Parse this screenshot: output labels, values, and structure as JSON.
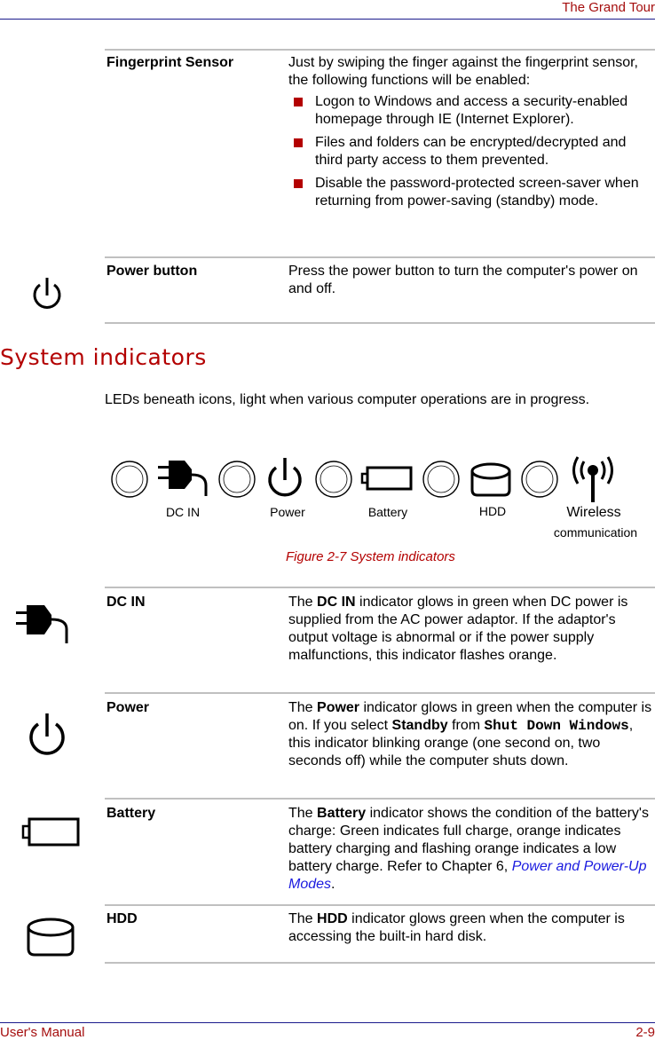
{
  "header": {
    "title": "The Grand Tour"
  },
  "footer": {
    "left": "User's Manual",
    "right": "2-9"
  },
  "features": [
    {
      "term": "Fingerprint Sensor",
      "intro": "Just by swiping the finger against the fingerprint sensor, the following functions will be enabled:",
      "bullets": [
        "Logon to Windows and access a security-enabled homepage through IE (Internet Explorer).",
        "Files and folders can be encrypted/decrypted and third party access to them prevented.",
        "Disable the password-protected screen-saver when returning from power-saving (standby) mode."
      ]
    },
    {
      "term": "Power button",
      "icon": "power-icon",
      "description": "Press the power button to turn the computer's power on and off."
    }
  ],
  "section": {
    "title": "System indicators",
    "intro": "LEDs beneath icons, light when various computer operations are in progress."
  },
  "figure": {
    "labels": [
      "DC IN",
      "Power",
      "Battery",
      "HDD",
      "Wireless",
      "communication"
    ],
    "caption": "Figure 2-7 System indicators"
  },
  "indicators": [
    {
      "term": "DC IN",
      "icon": "dc-in-plug-icon",
      "parts": {
        "a": "The ",
        "b": "DC IN",
        "c": " indicator glows in green when DC power is supplied from the AC power adaptor. If the adaptor's output voltage is abnormal or if the power supply malfunctions, this indicator flashes orange."
      }
    },
    {
      "term": "Power",
      "icon": "power-icon",
      "parts": {
        "a": "The ",
        "b": "Power",
        "c": " indicator glows in green when the computer is on. If you select ",
        "d": "Standby",
        "e": " from ",
        "f": "Shut Down Windows",
        "g": ", this indicator blinking orange (one second on, two seconds off) while the computer shuts down."
      }
    },
    {
      "term": "Battery",
      "icon": "battery-icon",
      "parts": {
        "a": "The ",
        "b": "Battery",
        "c": " indicator shows the condition of the battery's charge: Green indicates full charge, orange indicates battery charging and flashing orange indicates a low battery charge. Refer to Chapter 6, ",
        "link": "Power and Power-Up Modes",
        "d": "."
      }
    },
    {
      "term": "HDD",
      "icon": "hdd-icon",
      "parts": {
        "a": "The ",
        "b": "HDD",
        "c": " indicator glows green when the computer is accessing the built-in hard disk."
      }
    }
  ]
}
